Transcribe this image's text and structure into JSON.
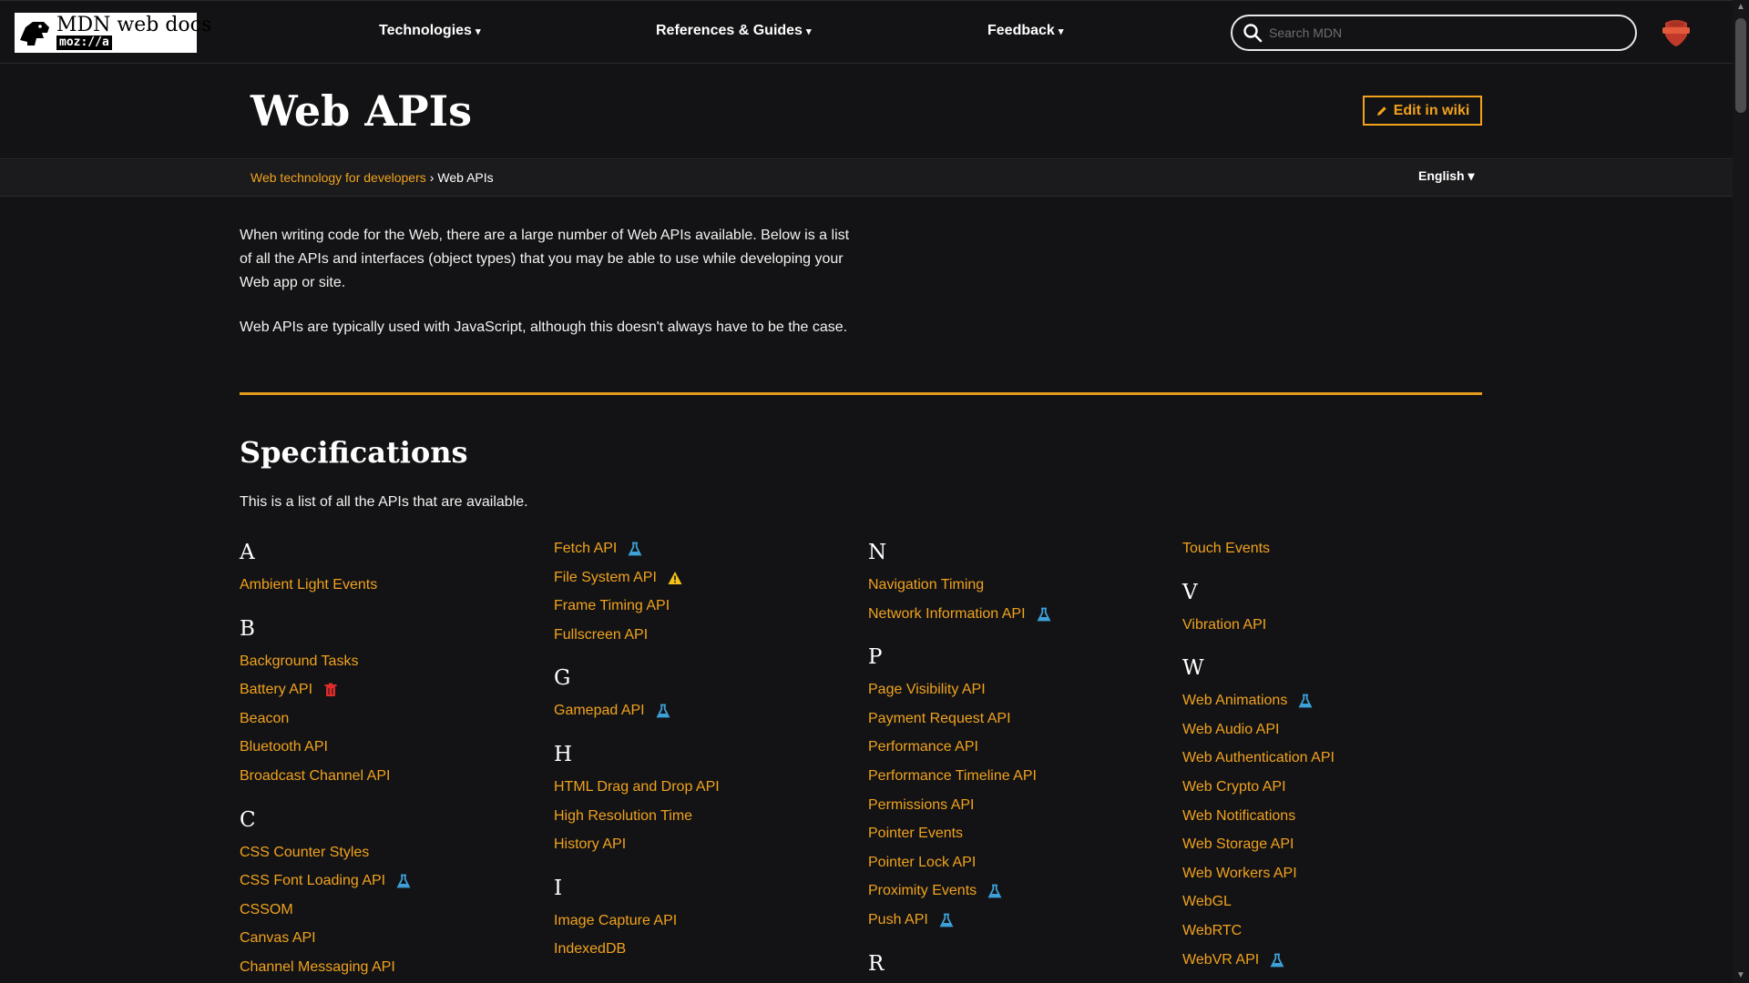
{
  "header": {
    "logo_text": "MDN web docs",
    "logo_sub": "moz://a",
    "nav": [
      {
        "label": "Technologies"
      },
      {
        "label": "References & Guides"
      },
      {
        "label": "Feedback"
      }
    ],
    "caret": "▾",
    "search_placeholder": "Search MDN"
  },
  "page": {
    "title": "Web APIs",
    "edit_label": "Edit in wiki",
    "breadcrumb": {
      "parent": "Web technology for developers",
      "separator": "›",
      "current": "Web APIs"
    },
    "language": "English ▾",
    "intro": [
      "When writing code for the Web, there are a large number of Web APIs available. Below is a list of all the APIs and interfaces (object types) that you may be able to use while developing your Web app or site.",
      "Web APIs are typically used with JavaScript, although this doesn't always have to be the case."
    ],
    "section_title": "Specifications",
    "section_desc": "This is a list of all the APIs that are available."
  },
  "colors": {
    "accent": "#f0a21d",
    "experimental": "#3ea0d8",
    "deprecated": "#e02b2b",
    "warning": "#f2c21b"
  },
  "api_columns": [
    {
      "groups": [
        {
          "letter": "A",
          "items": [
            {
              "name": "Ambient Light Events",
              "badge": null
            }
          ]
        },
        {
          "letter": "B",
          "items": [
            {
              "name": "Background Tasks",
              "badge": null
            },
            {
              "name": "Battery API",
              "badge": "deprecated-icon"
            },
            {
              "name": "Beacon",
              "badge": null
            },
            {
              "name": "Bluetooth API",
              "badge": null
            },
            {
              "name": "Broadcast Channel API",
              "badge": null
            }
          ]
        },
        {
          "letter": "C",
          "items": [
            {
              "name": "CSS Counter Styles",
              "badge": null
            },
            {
              "name": "CSS Font Loading API",
              "badge": "experimental-icon"
            },
            {
              "name": "CSSOM",
              "badge": null
            },
            {
              "name": "Canvas API",
              "badge": null
            },
            {
              "name": "Channel Messaging API",
              "badge": null
            }
          ]
        }
      ]
    },
    {
      "groups": [
        {
          "letter": "",
          "items": [
            {
              "name": "Fetch API",
              "badge": "experimental-icon"
            },
            {
              "name": "File System API",
              "badge": "warning-icon"
            },
            {
              "name": "Frame Timing API",
              "badge": null
            },
            {
              "name": "Fullscreen API",
              "badge": null
            }
          ]
        },
        {
          "letter": "G",
          "items": [
            {
              "name": "Gamepad API",
              "badge": "experimental-icon"
            }
          ]
        },
        {
          "letter": "H",
          "items": [
            {
              "name": "HTML Drag and Drop API",
              "badge": null
            },
            {
              "name": "High Resolution Time",
              "badge": null
            },
            {
              "name": "History API",
              "badge": null
            }
          ]
        },
        {
          "letter": "I",
          "items": [
            {
              "name": "Image Capture API",
              "badge": null
            },
            {
              "name": "IndexedDB",
              "badge": null
            }
          ]
        }
      ]
    },
    {
      "groups": [
        {
          "letter": "N",
          "items": [
            {
              "name": "Navigation Timing",
              "badge": null
            },
            {
              "name": "Network Information API",
              "badge": "experimental-icon"
            }
          ]
        },
        {
          "letter": "P",
          "items": [
            {
              "name": "Page Visibility API",
              "badge": null
            },
            {
              "name": "Payment Request API",
              "badge": null
            },
            {
              "name": "Performance API",
              "badge": null
            },
            {
              "name": "Performance Timeline API",
              "badge": null
            },
            {
              "name": "Permissions API",
              "badge": null
            },
            {
              "name": "Pointer Events",
              "badge": null
            },
            {
              "name": "Pointer Lock API",
              "badge": null
            },
            {
              "name": "Proximity Events",
              "badge": "experimental-icon"
            },
            {
              "name": "Push API",
              "badge": "experimental-icon"
            }
          ]
        },
        {
          "letter": "R",
          "items": []
        }
      ]
    },
    {
      "groups": [
        {
          "letter": "",
          "items": [
            {
              "name": "Touch Events",
              "badge": null
            }
          ]
        },
        {
          "letter": "V",
          "items": [
            {
              "name": "Vibration API",
              "badge": null
            }
          ]
        },
        {
          "letter": "W",
          "items": [
            {
              "name": "Web Animations",
              "badge": "experimental-icon"
            },
            {
              "name": "Web Audio API",
              "badge": null
            },
            {
              "name": "Web Authentication API",
              "badge": null
            },
            {
              "name": "Web Crypto API",
              "badge": null
            },
            {
              "name": "Web Notifications",
              "badge": null
            },
            {
              "name": "Web Storage API",
              "badge": null
            },
            {
              "name": "Web Workers API",
              "badge": null
            },
            {
              "name": "WebGL",
              "badge": null
            },
            {
              "name": "WebRTC",
              "badge": null
            },
            {
              "name": "WebVR API",
              "badge": "experimental-icon"
            }
          ]
        }
      ]
    }
  ]
}
